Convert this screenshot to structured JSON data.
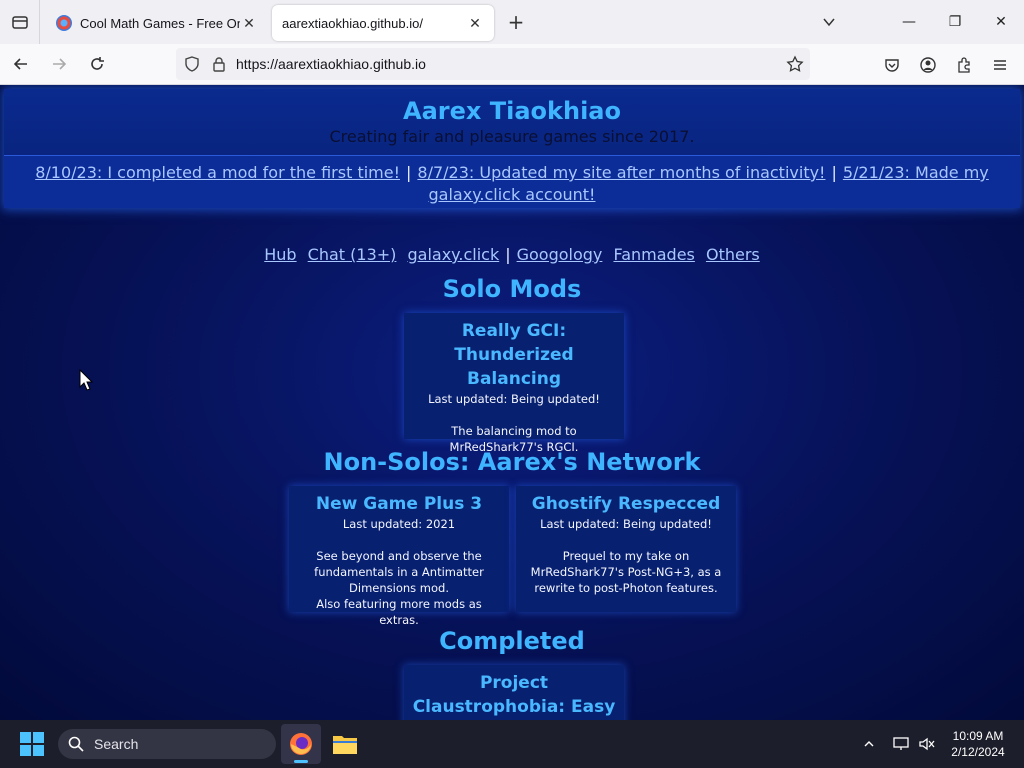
{
  "browser": {
    "tabs": [
      {
        "title": "Cool Math Games - Free Online",
        "close": "✕"
      },
      {
        "title": "aarextiaokhiao.github.io/",
        "close": "✕"
      }
    ],
    "new_tab": "+",
    "url": "https://aarextiaokhiao.github.io",
    "window_controls": {
      "minimize": "—",
      "restore": "❐",
      "close": "✕"
    }
  },
  "page": {
    "site_title": "Aarex Tiaokhiao",
    "site_subtitle": "Creating fair and pleasure games since 2017.",
    "news": [
      "8/10/23: I completed a mod for the first time!",
      "8/7/23: Updated my site after months of inactivity!",
      "5/21/23: Made my galaxy.click account!"
    ],
    "news_separator": "|",
    "links": [
      "Hub",
      "Chat (13+)",
      "galaxy.click",
      "Googology",
      "Fanmades",
      "Others"
    ],
    "link_separator": "|",
    "sections": [
      {
        "title": "Solo Mods",
        "cards": [
          {
            "title": "Really GCI: Thunderized Balancing",
            "updated": "Last updated: Being updated!",
            "desc": "The balancing mod to MrRedShark77's RGCI."
          }
        ]
      },
      {
        "title": "Non-Solos: Aarex's Network",
        "cards": [
          {
            "title": "New Game Plus 3",
            "updated": "Last updated: 2021",
            "desc": "See beyond and observe the fundamentals in a Antimatter Dimensions mod.",
            "desc2": "Also featuring more mods as extras."
          },
          {
            "title": "Ghostify Respecced",
            "updated": "Last updated: Being updated!",
            "desc": "Prequel to my take on MrRedShark77's Post-NG+3, as a rewrite to post-Photon features."
          }
        ]
      },
      {
        "title": "Completed",
        "cards": [
          {
            "title": "Project Claustrophobia: Easy Mode"
          }
        ]
      }
    ]
  },
  "taskbar": {
    "search_placeholder": "Search",
    "time": "10:09 AM",
    "date": "2/12/2024"
  },
  "colors": {
    "accent": "#3fb4ff",
    "link": "#a9c7ff",
    "background": "#07135c",
    "taskbar": "#1d1e2b"
  }
}
